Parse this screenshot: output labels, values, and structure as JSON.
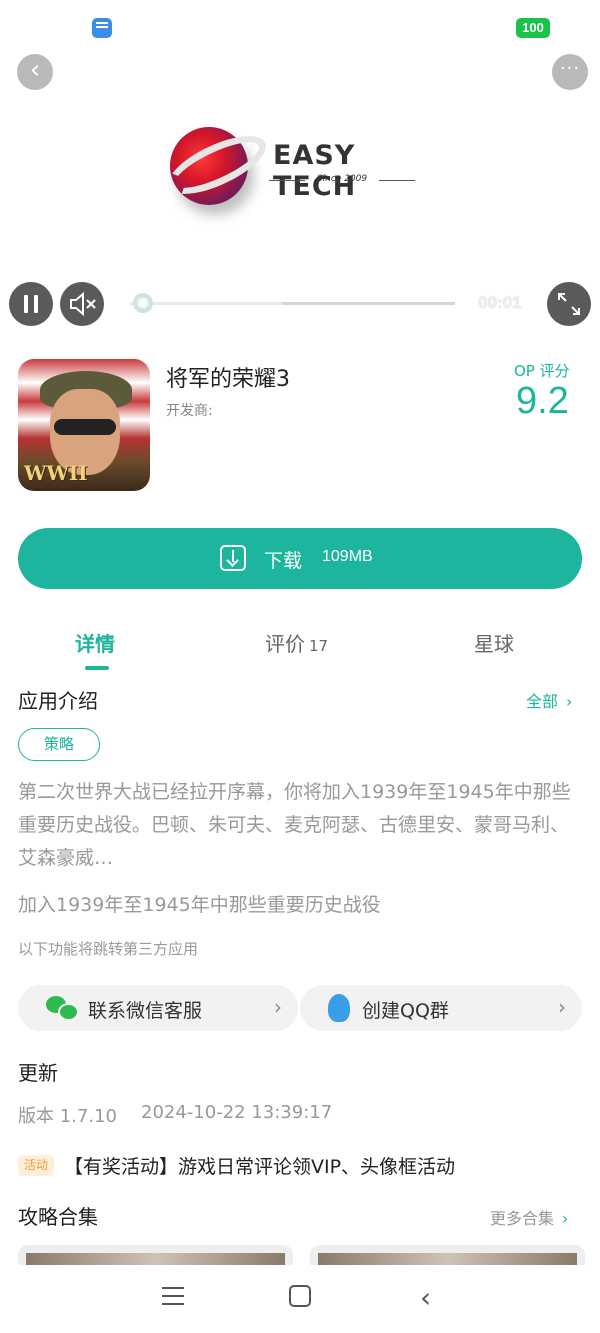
{
  "status_bar": {
    "battery": "100"
  },
  "video": {
    "logo_text": "EASY TECH",
    "logo_sub": "Since 2009",
    "time": "00:01"
  },
  "app": {
    "title": "将军的荣耀3",
    "developer_label": "开发商:",
    "op_label": "OP 评分",
    "op_score": "9.2",
    "icon_badge": "WWII"
  },
  "download": {
    "label": "下载",
    "size": "109MB"
  },
  "tabs": [
    {
      "label": "详情",
      "count": ""
    },
    {
      "label": "评价",
      "count": "17"
    },
    {
      "label": "星球",
      "count": ""
    }
  ],
  "intro": {
    "title": "应用介绍",
    "more": "全部",
    "tag": "策略",
    "description": "第二次世界大战已经拉开序幕，你将加入1939年至1945年中那些重要历史战役。巴顿、朱可夫、麦克阿瑟、古德里安、蒙哥马利、艾森豪威…",
    "line2": "加入1939年至1945年中那些重要历史战役",
    "note": "以下功能将跳转第三方应用"
  },
  "cards": {
    "wechat": "联系微信客服",
    "qq": "创建QQ群"
  },
  "update": {
    "title": "更新",
    "version": "版本 1.7.10",
    "date": "2024-10-22 13:39:17",
    "badge": "活动",
    "event": "【有奖活动】游戏日常评论领VIP、头像框活动"
  },
  "guides": {
    "title": "攻略合集",
    "more": "更多合集"
  },
  "colors": {
    "accent": "#1db59d",
    "battery": "#19c34a"
  },
  "icons": [
    "back-icon",
    "more-icon",
    "pause-icon",
    "mute-icon",
    "fullscreen-icon",
    "download-icon",
    "wechat-icon",
    "qq-icon",
    "chevron-right-icon",
    "menu-icon",
    "home-icon",
    "nav-back-icon"
  ]
}
